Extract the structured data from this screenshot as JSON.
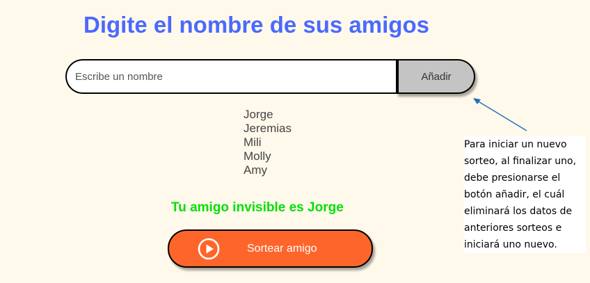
{
  "header": {
    "title": "Digite el nombre de sus amigos"
  },
  "input": {
    "placeholder": "Escribe un nombre",
    "value": ""
  },
  "add_button": {
    "label": "Añadir"
  },
  "friends": [
    "Jorge",
    "Jeremias",
    "Mili",
    "Molly",
    "Amy"
  ],
  "result": {
    "text": "Tu amigo invisible es Jorge"
  },
  "draw_button": {
    "label": "Sortear amigo",
    "icon": "play-circle-icon"
  },
  "annotation": {
    "text": "Para iniciar un nuevo sorteo, al finalizar uno, debe presionarse el botón añadir, el cuál eliminará los datos de anteriores sorteos e iniciará uno nuevo."
  },
  "colors": {
    "background": "#fff9eb",
    "title": "#4b69fd",
    "result": "#05df05",
    "draw_button": "#fe652b",
    "add_button": "#c4c4c4",
    "arrow": "#1f6fbf"
  }
}
